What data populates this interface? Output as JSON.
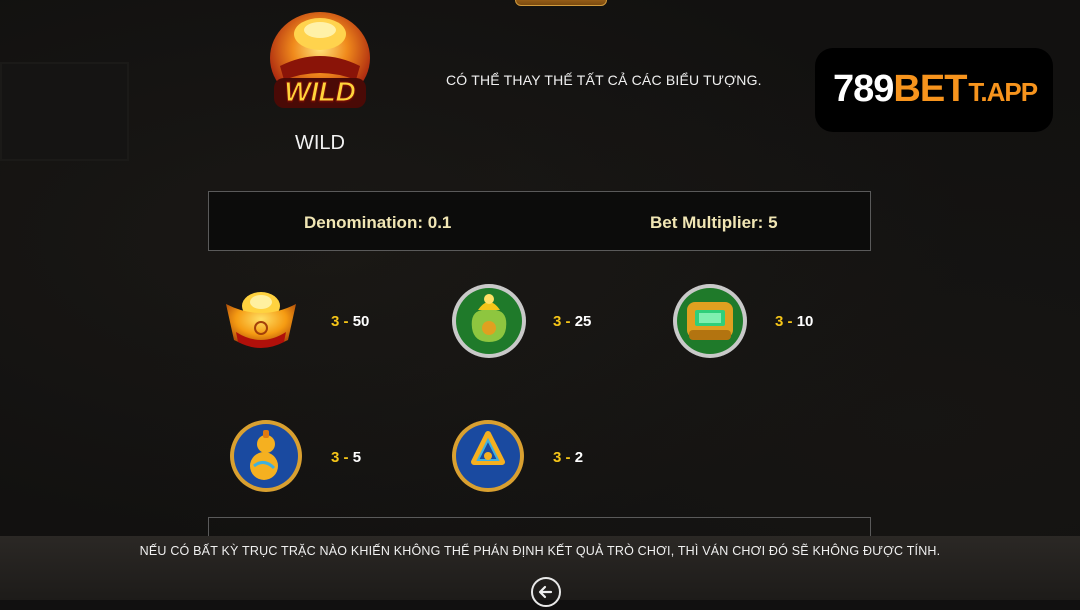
{
  "wild": {
    "icon": "wild-ingot-bowl-icon",
    "name": "WILD",
    "description": "CÓ THỂ THAY THẾ TẤT CẢ CÁC BIỂU TƯỢNG.",
    "icon_label": "WILD"
  },
  "logo": {
    "number": "789",
    "bet": "BET",
    "app": "T.APP",
    "colors": {
      "number": "#ffffff",
      "bet": "#f7941d"
    }
  },
  "config": {
    "denomination_label": "Denomination:",
    "denomination_value": "0.1",
    "bet_multiplier_label": "Bet Multiplier:",
    "bet_multiplier_value": "5"
  },
  "paytable": [
    {
      "icon": "gold-ingot-icon",
      "count": "3",
      "separator": "-",
      "payout": "50"
    },
    {
      "icon": "money-bag-icon",
      "count": "3",
      "separator": "-",
      "payout": "25"
    },
    {
      "icon": "jade-ring-icon",
      "count": "3",
      "separator": "-",
      "payout": "10"
    },
    {
      "icon": "gourd-icon",
      "count": "3",
      "separator": "-",
      "payout": "5"
    },
    {
      "icon": "lucky-knot-icon",
      "count": "3",
      "separator": "-",
      "payout": "2"
    }
  ],
  "notice": "NẾU CÓ BẤT KỲ TRỤC TRẶC NÀO KHIẾN KHÔNG THỂ PHÁN ĐỊNH KẾT QUẢ TRÒ CHƠI, THÌ VÁN CHƠI ĐÓ SẼ KHÔNG ĐƯỢC TÍNH.",
  "back_button": {
    "icon": "arrow-left-icon"
  },
  "colors": {
    "accent_gold": "#f5c518",
    "label_cream": "#f1e6b4",
    "background": "#121110"
  }
}
